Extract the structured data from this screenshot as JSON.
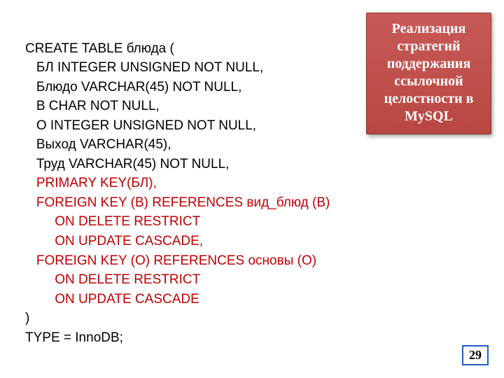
{
  "code": {
    "l1": "CREATE TABLE блюда (",
    "l2": "   БЛ INTEGER UNSIGNED NOT NULL,",
    "l3": "   Блюдо VARCHAR(45) NOT NULL,",
    "l4": "   В CHAR NOT NULL,",
    "l5": "   О INTEGER UNSIGNED NOT NULL,",
    "l6": "   Выход VARCHAR(45),",
    "l7": "   Труд VARCHAR(45) NOT NULL,",
    "l8": "   PRIMARY KEY(БЛ),",
    "l9": "   FOREIGN KEY (В) REFERENCES вид_блюд (В)",
    "l10": "        ON DELETE RESTRICT",
    "l11": "        ON UPDATE CASCADE,",
    "l12": "   FOREIGN KEY (О) REFERENCES основы (О)",
    "l13": "        ON DELETE RESTRICT",
    "l14": "        ON UPDATE CASCADE",
    "l15": ")",
    "l16": "TYPE = InnoDB;"
  },
  "callout": {
    "t1": "Реализация",
    "t2": "стратегий",
    "t3": "поддержания",
    "t4": "ссылочной",
    "t5": "целостности в",
    "t6": "MySQL"
  },
  "page_number": "29"
}
